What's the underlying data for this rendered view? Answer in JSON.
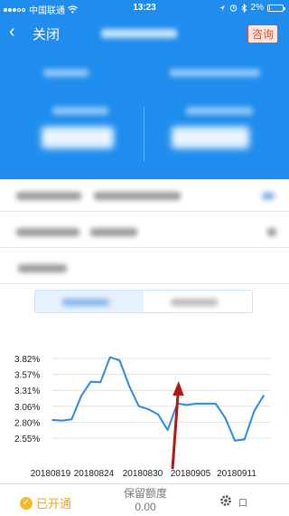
{
  "status_bar": {
    "carrier": "中国联通",
    "time": "13:23",
    "battery": "2%"
  },
  "header": {
    "back_icon": "chevron-left-icon",
    "close_label": "关闭",
    "consult_label": "咨询"
  },
  "chart_data": {
    "type": "line",
    "color": "#2a8be0",
    "y_tick_labels": [
      "3.82%",
      "3.57%",
      "3.31%",
      "3.06%",
      "2.80%",
      "2.55%"
    ],
    "ylim": [
      2.55,
      3.82
    ],
    "x_tick_labels": [
      "20180819",
      "20180824",
      "20180830",
      "20180905",
      "20180911"
    ],
    "values": [
      2.84,
      2.83,
      2.85,
      3.22,
      3.45,
      3.44,
      3.84,
      3.79,
      3.38,
      3.06,
      3.01,
      2.93,
      2.68,
      3.1,
      3.08,
      3.1,
      3.1,
      3.1,
      2.87,
      2.51,
      2.53,
      2.98,
      3.23
    ],
    "annotation": "red-arrow-up"
  },
  "bottom_bar": {
    "opened_label": "已开通",
    "reserve_label": "保留额度",
    "reserve_value": "0.00",
    "more_label": "口"
  }
}
